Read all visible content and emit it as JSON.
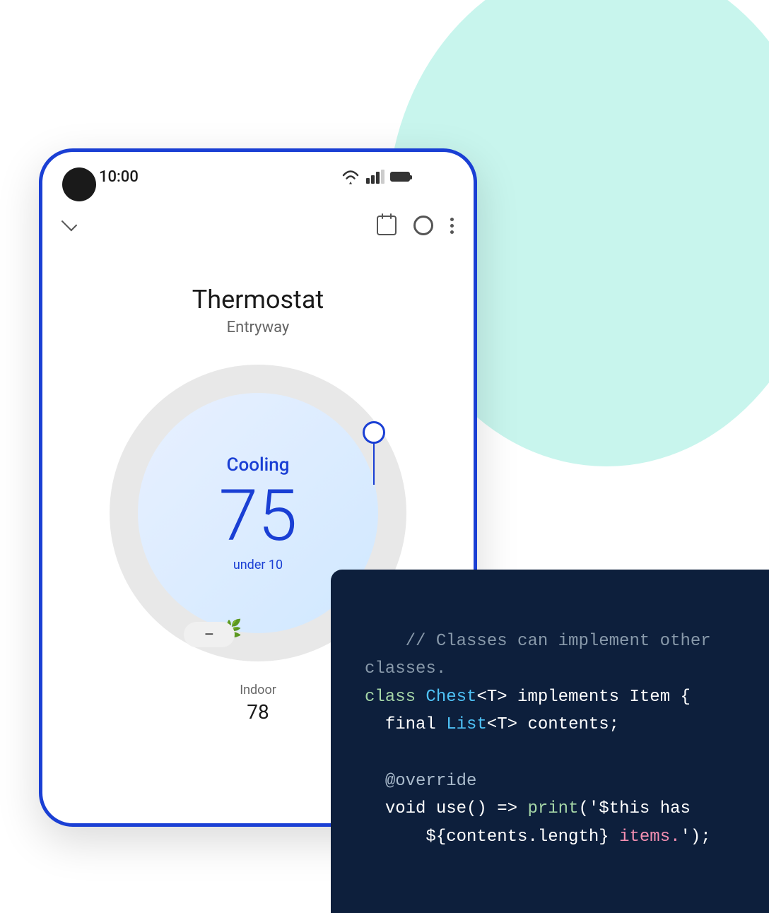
{
  "background": {
    "circle_color": "#c8f5ed"
  },
  "phone": {
    "status_bar": {
      "time": "10:00"
    },
    "app_bar": {
      "chevron": "chevron-down",
      "calendar": "calendar-icon",
      "settings": "settings-icon",
      "more": "more-vert-icon"
    },
    "thermostat": {
      "title": "Thermostat",
      "subtitle": "Entryway",
      "mode": "Cooling",
      "temperature": "75",
      "under_text": "under 10",
      "minus_label": "–",
      "indoor_label": "Indoor",
      "indoor_value": "78"
    }
  },
  "code_panel": {
    "lines": [
      {
        "type": "comment",
        "text": "// Classes can implement other"
      },
      {
        "type": "comment",
        "text": "classes."
      },
      {
        "type": "code",
        "parts": [
          {
            "color": "green",
            "text": "class "
          },
          {
            "color": "class",
            "text": "Chest"
          },
          {
            "color": "white",
            "text": "<T> "
          },
          {
            "color": "white",
            "text": "implements "
          },
          {
            "color": "white",
            "text": "Item {"
          }
        ]
      },
      {
        "type": "code",
        "parts": [
          {
            "color": "white",
            "text": "  final "
          },
          {
            "color": "class",
            "text": "List"
          },
          {
            "color": "white",
            "text": "<T> contents;"
          }
        ]
      },
      {
        "type": "blank"
      },
      {
        "type": "code",
        "parts": [
          {
            "color": "annotation",
            "text": "  @override"
          }
        ]
      },
      {
        "type": "code",
        "parts": [
          {
            "color": "white",
            "text": "  void use() => "
          },
          {
            "color": "green",
            "text": "print"
          },
          {
            "color": "white",
            "text": "('$this has"
          }
        ]
      },
      {
        "type": "code",
        "parts": [
          {
            "color": "white",
            "text": "      ${contents.length} "
          },
          {
            "color": "string",
            "text": "items."
          },
          {
            "color": "white",
            "text": "');"
          }
        ]
      }
    ]
  }
}
